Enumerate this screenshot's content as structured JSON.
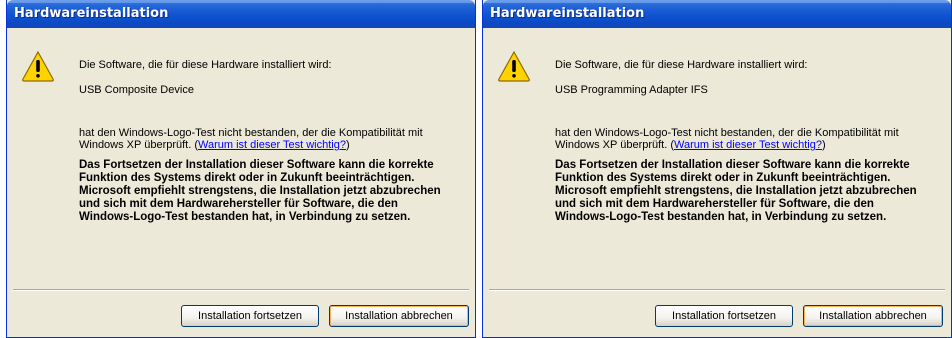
{
  "colors": {
    "title_bar": "#0c49c3",
    "dialog_bg": "#ece9d8",
    "link": "#0000ff",
    "warning_icon": "#ffd200"
  },
  "dialogs": [
    {
      "title": "Hardwareinstallation",
      "icon": "warning-triangle-icon",
      "intro": "Die Software, die für diese Hardware installiert wird:",
      "device_name": "USB Composite Device",
      "logo_test_line1": "hat den Windows-Logo-Test nicht bestanden, der die Kompatibilität mit",
      "logo_test_line2_prefix": "Windows XP überprüft. (",
      "logo_test_link": "Warum ist dieser Test wichtig?",
      "logo_test_line2_suffix": ")",
      "warning_lines": [
        "Das Fortsetzen der Installation dieser Software kann die korrekte",
        "Funktion des Systems direkt oder in Zukunft beeinträchtigen.",
        "Microsoft empfiehlt strengstens, die Installation jetzt abzubrechen",
        "und sich mit dem Hardwarehersteller für Software, die den",
        "Windows-Logo-Test bestanden hat, in Verbindung zu setzen."
      ],
      "continue_button": "Installation fortsetzen",
      "cancel_button": "Installation abbrechen"
    },
    {
      "title": "Hardwareinstallation",
      "icon": "warning-triangle-icon",
      "intro": "Die Software, die für diese Hardware installiert wird:",
      "device_name": "USB Programming Adapter IFS",
      "logo_test_line1": "hat den Windows-Logo-Test nicht bestanden, der die Kompatibilität mit",
      "logo_test_line2_prefix": "Windows XP überprüft. (",
      "logo_test_link": "Warum ist dieser Test wichtig?",
      "logo_test_line2_suffix": ")",
      "warning_lines": [
        "Das Fortsetzen der Installation dieser Software kann die korrekte",
        "Funktion des Systems direkt oder in Zukunft beeinträchtigen.",
        "Microsoft empfiehlt strengstens, die Installation jetzt abzubrechen",
        "und sich mit dem Hardwarehersteller für Software, die den",
        "Windows-Logo-Test bestanden hat, in Verbindung zu setzen."
      ],
      "continue_button": "Installation fortsetzen",
      "cancel_button": "Installation abbrechen"
    }
  ]
}
